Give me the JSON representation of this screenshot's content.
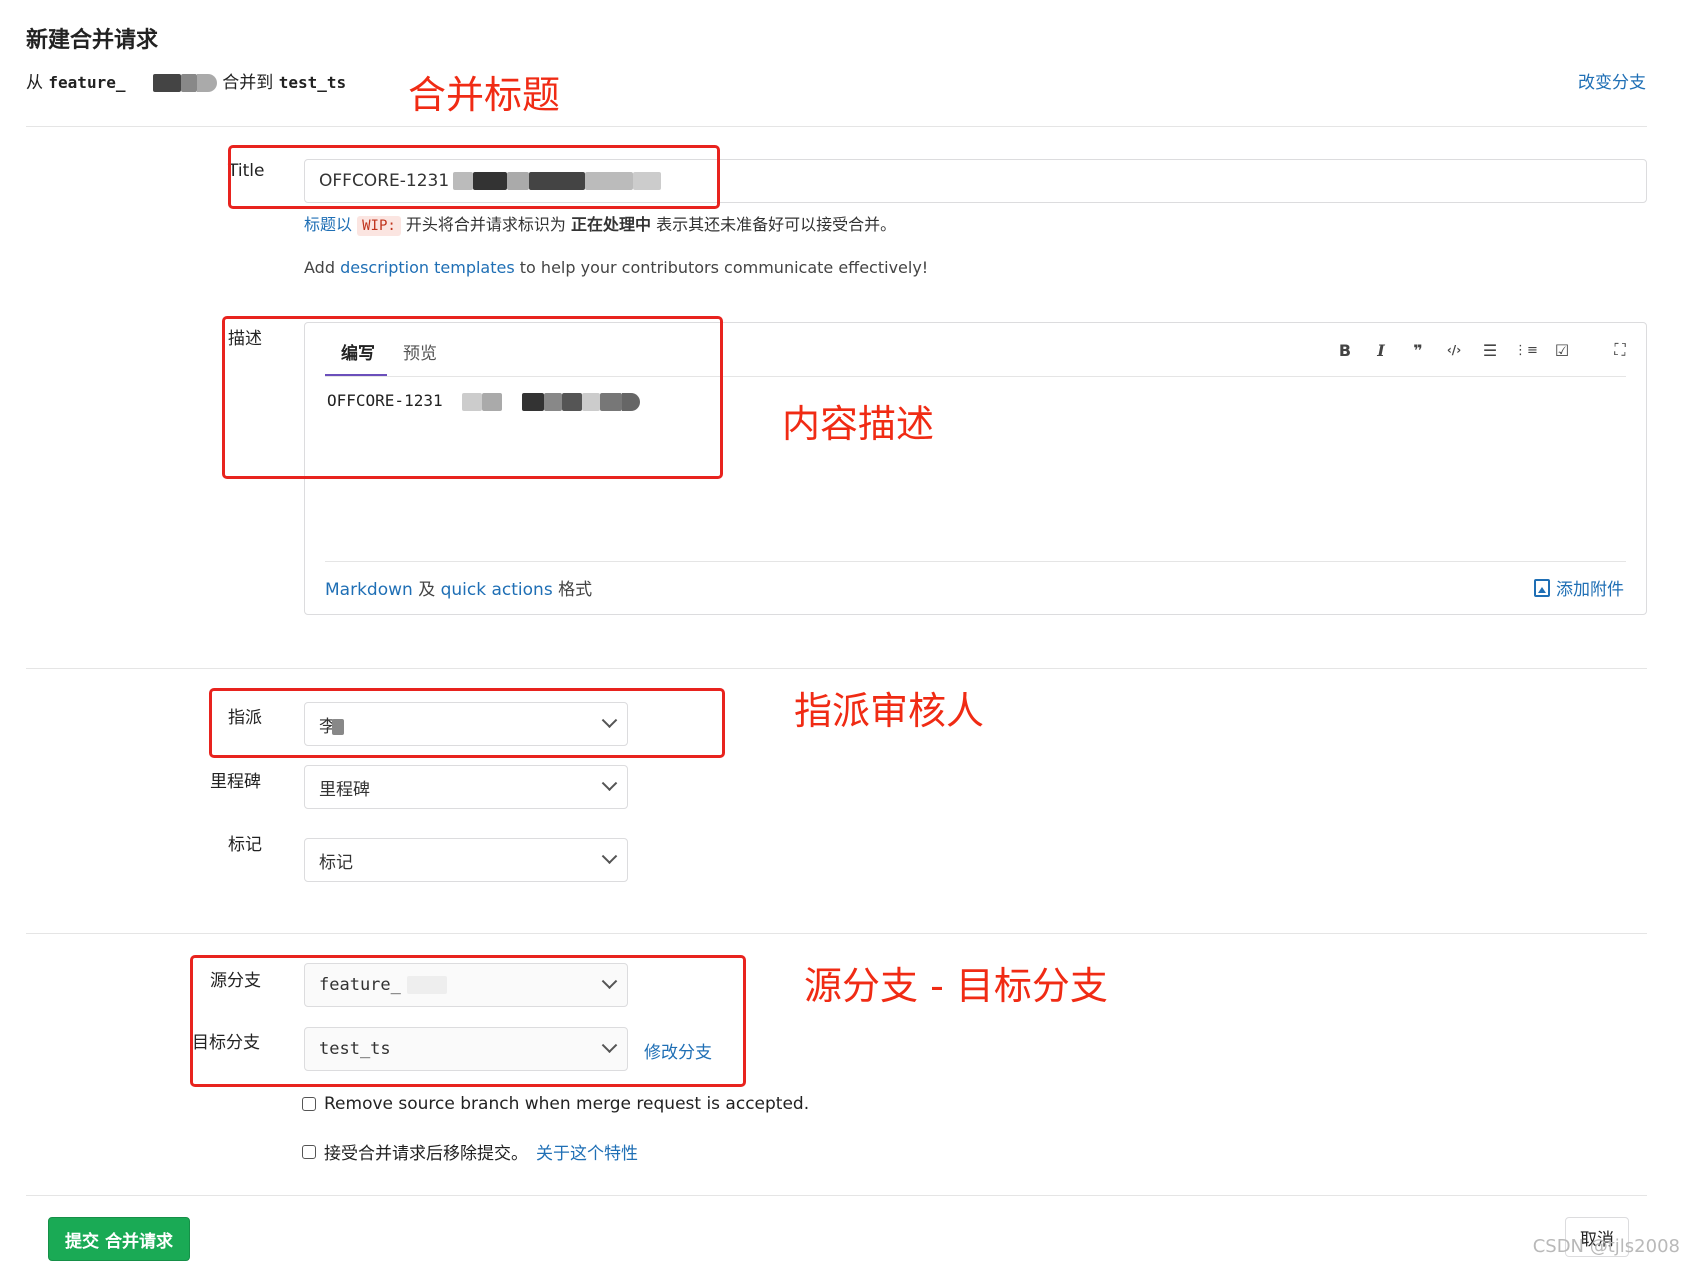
{
  "page": {
    "title": "新建合并请求",
    "from_prefix": "从",
    "source_branch": "feature_",
    "merge_into": "合并到",
    "target_branch": "test_ts",
    "change_branches": "改变分支"
  },
  "title_field": {
    "label": "Title",
    "value": "OFFCORE-1231",
    "wip_hint_prefix": "标题以",
    "wip_code": "WIP:",
    "wip_hint_mid": "开头将合并请求标识为",
    "wip_hint_bold": "正在处理中",
    "wip_hint_suffix": "表示其还未准备好可以接受合并。"
  },
  "templates_hint": {
    "prefix": "Add",
    "link": "description templates",
    "suffix": "to help your contributors communicate effectively!"
  },
  "description": {
    "label": "描述",
    "tab_write": "编写",
    "tab_preview": "预览",
    "content": "OFFCORE-1231",
    "toolbar": [
      "B",
      "I",
      "❞",
      "‹/›",
      "☰",
      "⋮≡",
      "☑",
      "⛶"
    ],
    "markdown_link": "Markdown",
    "and_text": "及",
    "quick_actions_link": "quick actions",
    "format_text": "格式",
    "attach_label": "添加附件"
  },
  "assignee": {
    "label": "指派",
    "value": "李"
  },
  "milestone": {
    "label": "里程碑",
    "value": "里程碑"
  },
  "labels_field": {
    "label": "标记",
    "value": "标记"
  },
  "source_branch_field": {
    "label": "源分支",
    "value": "feature_"
  },
  "target_branch_field": {
    "label": "目标分支",
    "value": "test_ts",
    "change_link": "修改分支"
  },
  "options": {
    "remove_source": "Remove source branch when merge request is accepted.",
    "squash": "接受合并请求后移除提交。",
    "squash_link": "关于这个特性"
  },
  "actions": {
    "submit": "提交 合并请求",
    "cancel": "取消"
  },
  "annotations": {
    "title_note": "合并标题",
    "desc_note": "内容描述",
    "assignee_note": "指派审核人",
    "branch_note": "源分支 - 目标分支"
  },
  "watermark": "CSDN @tjls2008",
  "colors": {
    "accent": "#1f6fb5",
    "submit": "#1aaa55",
    "annotation": "#f02b14",
    "tab_underline": "#6b4fbb"
  }
}
